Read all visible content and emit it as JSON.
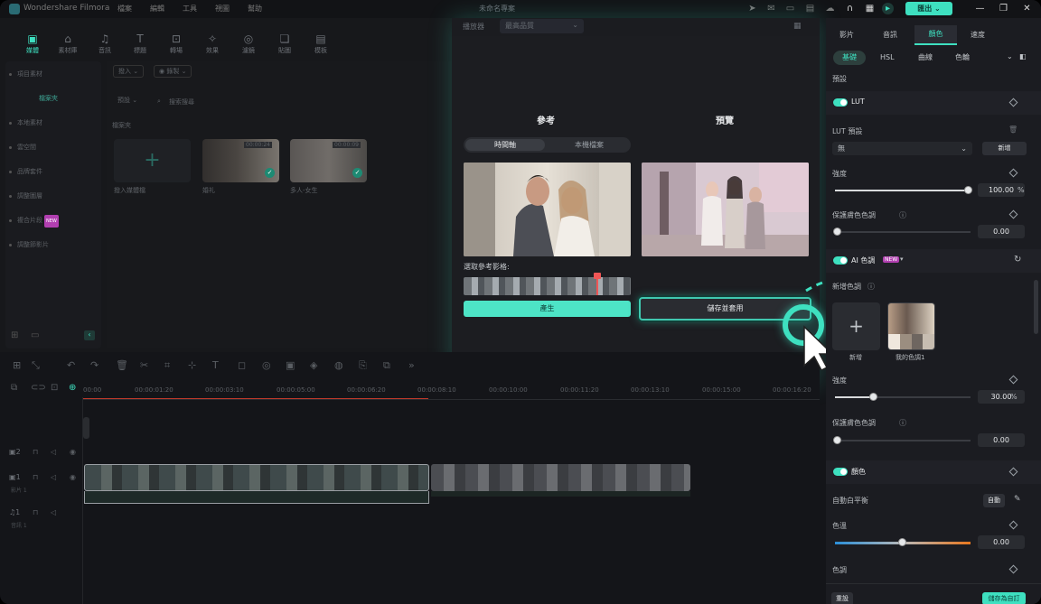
{
  "titlebar": {
    "app_name": "Wondershare Filmora",
    "menu": [
      "檔案",
      "編輯",
      "工具",
      "視圖",
      "幫助"
    ],
    "project_name": "未命名專案",
    "export_label": "匯出"
  },
  "toolbar": {
    "items": [
      {
        "label": "媒體",
        "icon": "media-icon"
      },
      {
        "label": "素材庫",
        "icon": "stock-icon"
      },
      {
        "label": "音訊",
        "icon": "music-icon"
      },
      {
        "label": "標題",
        "icon": "title-icon"
      },
      {
        "label": "轉場",
        "icon": "transition-icon"
      },
      {
        "label": "效果",
        "icon": "effects-icon"
      },
      {
        "label": "濾鏡",
        "icon": "filter-icon"
      },
      {
        "label": "貼圖",
        "icon": "sticker-icon"
      },
      {
        "label": "模板",
        "icon": "template-icon"
      }
    ]
  },
  "library": {
    "items": [
      "項目素材",
      "檔案夾",
      "本地素材",
      "雲空間",
      "品牌套件",
      "調整圖層",
      "複合片段",
      "調整節影片"
    ],
    "new_badge": "NEW"
  },
  "media": {
    "import_label": "撥入",
    "record_label": "錄製",
    "preset_label": "預設",
    "search_placeholder": "搜索搜尋",
    "folder_label": "檔案夾",
    "import_media": "撥入媒體檔",
    "clip1_name": "婚礼",
    "clip1_time": "00:00:24",
    "clip2_name": "多人-女生",
    "clip2_time": "00:00:09"
  },
  "viewer": {
    "player_label": "播放器",
    "quality": "最高品質"
  },
  "color_match": {
    "reference_title": "參考",
    "preview_title": "預覽",
    "tab_timeline": "時間軸",
    "tab_local": "本機檔案",
    "pick_label": "選取參考影格:",
    "generate_label": "產生",
    "save_apply_label": "儲存並套用"
  },
  "timeline": {
    "ruler": [
      "00:00",
      "00:00:01:20",
      "00:00:03:10",
      "00:00:05:00",
      "00:00:06:20",
      "00:00:08:10",
      "00:00:10:00",
      "00:00:11:20",
      "00:00:13:10",
      "00:00:15:00",
      "00:00:16:20"
    ],
    "track_video2": "2",
    "track_video1": "1",
    "track_video1_name": "影片 1",
    "track_audio1": "1",
    "track_audio1_name": "音訊 1"
  },
  "right_panel": {
    "tabs": [
      "影片",
      "音訊",
      "顏色",
      "速度"
    ],
    "active_tab": "顏色",
    "subtabs": [
      "基礎",
      "HSL",
      "曲線",
      "色輪"
    ],
    "preset_label": "預設",
    "lut": {
      "title": "LUT",
      "preset_label": "LUT 預設",
      "preset_value": "無",
      "add_label": "新增",
      "strength_label": "強度",
      "strength_value": "100.00",
      "strength_unit": "%",
      "protect_label": "保護膚色色調",
      "protect_value": "0.00"
    },
    "ai": {
      "title": "AI 色調",
      "badge": "NEW",
      "new_tone_label": "新增色調",
      "add_label": "新增",
      "my_tone_label": "我的色調1",
      "strength_label": "強度",
      "strength_value": "30.00",
      "strength_unit": "%",
      "protect_label": "保護膚色色調",
      "protect_value": "0.00"
    },
    "color": {
      "title": "顏色",
      "wb_label": "自動白平衡",
      "auto_label": "自動",
      "temp_label": "色溫",
      "temp_value": "0.00",
      "tint_label": "色調"
    },
    "reset_label": "重設",
    "save_custom_label": "儲存為自訂"
  }
}
